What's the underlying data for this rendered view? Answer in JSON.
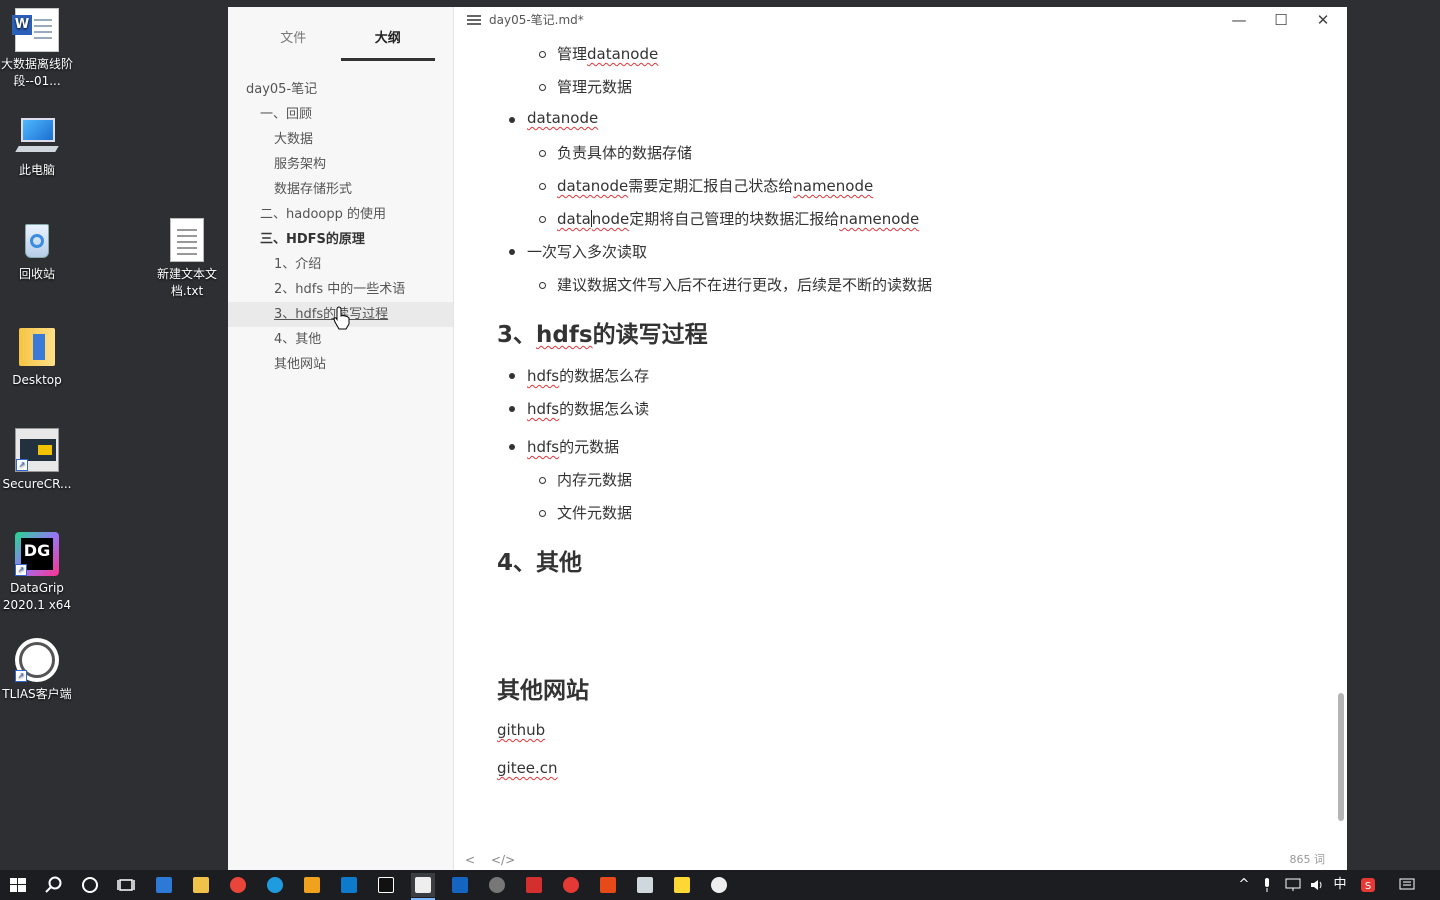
{
  "desktop": {
    "icons": [
      {
        "label": "大数据离线阶段--01...",
        "icon": "word-doc-icon"
      },
      {
        "label": "此电脑",
        "icon": "this-pc-icon"
      },
      {
        "label": "回收站",
        "icon": "recycle-bin-icon"
      },
      {
        "label": "新建文本文档.txt",
        "icon": "text-file-icon"
      },
      {
        "label": "Desktop",
        "icon": "folder-icon"
      },
      {
        "label": "SecureCR...",
        "icon": "securecrt-icon"
      },
      {
        "label": "DataGrip 2020.1 x64",
        "icon": "datagrip-icon"
      },
      {
        "label": "TLIAS客户端",
        "icon": "tlias-icon"
      }
    ],
    "datagrip_glyph": "DG",
    "word_glyph": "W"
  },
  "window": {
    "title": "day05-笔记.md*",
    "controls": {
      "minimize": "—",
      "maximize": "☐",
      "close": "✕"
    },
    "sidebar": {
      "tabs": [
        "文件",
        "大纲"
      ],
      "active_tab": "大纲",
      "outline": [
        {
          "label": "day05-笔记",
          "level": 1
        },
        {
          "label": "一、回顾",
          "level": 2
        },
        {
          "label": "大数据",
          "level": 3
        },
        {
          "label": "服务架构",
          "level": 3
        },
        {
          "label": "数据存储形式",
          "level": 3
        },
        {
          "label": "二、hadoopp 的使用",
          "level": 2
        },
        {
          "label": "三、HDFS的原理",
          "level": 2
        },
        {
          "label": "1、介绍",
          "level": 3
        },
        {
          "label": "2、hdfs 中的一些术语",
          "level": 3
        },
        {
          "label": "3、hdfs的读写过程",
          "level": 3
        },
        {
          "label": "4、其他",
          "level": 3
        },
        {
          "label": "其他网站",
          "level": 3
        }
      ]
    },
    "document": {
      "lines": {
        "l1": {
          "a": "管理",
          "b": "datanode"
        },
        "l2": "管理元数据",
        "l3": "datanode",
        "l4": "负责具体的数据存储",
        "l5": {
          "a": "datanode",
          "b": "需要定期汇报自己状态给",
          "c": "namenode"
        },
        "l6": {
          "a1": "data",
          "a2": "node",
          "b": "定期将自己管理的块数据汇报给",
          "c": "namenode"
        },
        "l7": "一次写入多次读取",
        "l8": "建议数据文件写入后不在进行更改，后续是不断的读数据",
        "h_rw": {
          "a": "3、",
          "b": "hdfs",
          "c": "的读写过程"
        },
        "l9": {
          "a": "hdfs",
          "b": "的数据怎么存"
        },
        "l10": {
          "a": "hdfs",
          "b": "的数据怎么读"
        },
        "l11": {
          "a": "hdfs",
          "b": "的元数据"
        },
        "l12": "内存元数据",
        "l13": "文件元数据",
        "h_other": "4、其他",
        "h_sites": "其他网站",
        "link1": "github",
        "link2": "gitee.cn"
      }
    },
    "footer": {
      "back": "<",
      "source": "</>",
      "word_count": "865 词"
    }
  },
  "taskbar": {
    "tray": {
      "up": "^",
      "ime": "中"
    }
  }
}
